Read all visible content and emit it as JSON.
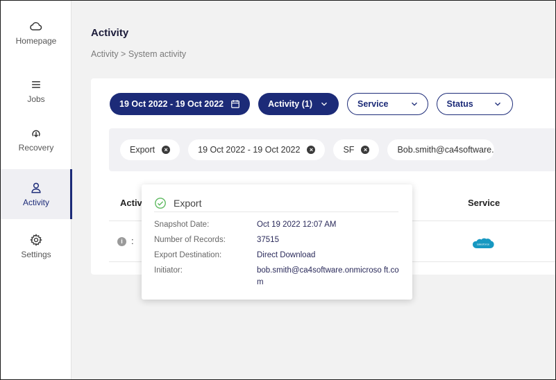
{
  "colors": {
    "primary": "#1c2b78",
    "success": "#5bb85d",
    "salesforce": "#1798c1"
  },
  "sidebar": {
    "items": [
      {
        "label": "Homepage",
        "icon": "cloud-icon"
      },
      {
        "label": "Jobs",
        "icon": "list-icon"
      },
      {
        "label": "Recovery",
        "icon": "recovery-icon"
      },
      {
        "label": "Activity",
        "icon": "user-icon",
        "active": true
      },
      {
        "label": "Settings",
        "icon": "gear-icon"
      }
    ]
  },
  "header": {
    "title": "Activity",
    "breadcrumb": "Activity > System activity"
  },
  "filters": {
    "date_range": "19 Oct 2022 - 19 Oct 2022",
    "activity": "Activity (1)",
    "service": "Service",
    "status": "Status"
  },
  "chips": [
    {
      "label": "Export"
    },
    {
      "label": "19 Oct 2022 - 19 Oct 2022"
    },
    {
      "label": "SF"
    },
    {
      "label": "Bob.smith@ca4software."
    }
  ],
  "table": {
    "headers": {
      "activity": "Activi",
      "service": "Service"
    },
    "row": {
      "activity_truncated": ":"
    }
  },
  "tooltip": {
    "title": "Export",
    "fields": [
      {
        "key": "Snapshot Date:",
        "value": "Oct 19 2022 12:07 AM"
      },
      {
        "key": "Number of Records:",
        "value": "37515"
      },
      {
        "key": "Export Destination:",
        "value": "Direct Download"
      },
      {
        "key": "Initiator:",
        "value": "bob.smith@ca4software.onmicroso ft.com"
      }
    ]
  }
}
